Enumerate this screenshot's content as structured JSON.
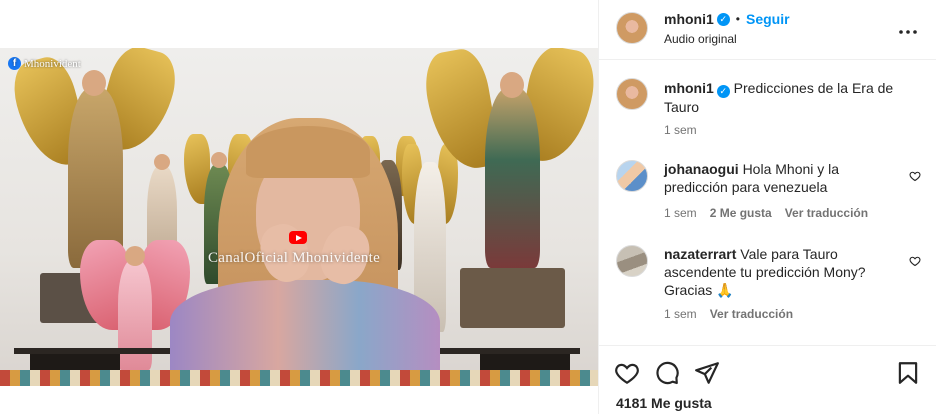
{
  "video": {
    "watermark_fb": "Mhonivident",
    "watermark_center": "CanalOficial  Mhonividente"
  },
  "header": {
    "username": "mhoni1",
    "separator": "•",
    "follow_label": "Seguir",
    "audio_label": "Audio original",
    "more_label": "•••"
  },
  "caption": {
    "username": "mhoni1",
    "text": "Predicciones de la Era de Tauro",
    "time": "1 sem"
  },
  "comments": [
    {
      "username": "johanaogui",
      "text": "Hola Mhoni y la predicción para venezuela",
      "time": "1 sem",
      "likes": "2 Me gusta",
      "translate": "Ver traducción"
    },
    {
      "username": "nazaterrart",
      "text": "Vale para Tauro ascendente tu predicción Mony? Gracias 🙏",
      "time": "1 sem",
      "translate": "Ver traducción"
    }
  ],
  "footer": {
    "likes": "4181 Me gusta"
  },
  "icons": {
    "verified": "verified-badge-icon",
    "mute": "muted-speaker-icon",
    "like": "heart-icon",
    "comment": "comment-bubble-icon",
    "share": "paper-plane-icon",
    "save": "bookmark-icon"
  },
  "colors": {
    "accent": "#0095f6",
    "text": "#262626",
    "secondary": "#737373",
    "border": "#efefef"
  }
}
